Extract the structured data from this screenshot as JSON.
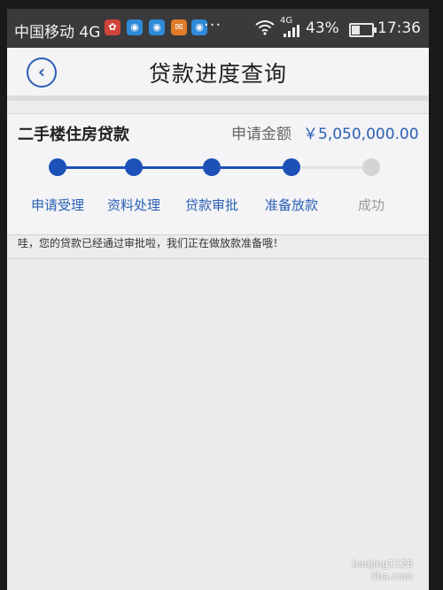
{
  "status_bar": {
    "carrier": "中国移动 4G",
    "network_small": "4G",
    "battery": "43%",
    "time": "17:36",
    "more": "···"
  },
  "header": {
    "back_icon": "chevron-left-icon",
    "title": "贷款进度查询"
  },
  "loan": {
    "type": "二手楼住房贷款",
    "amount_label": "申请金额",
    "amount_value": "￥5,050,000.00"
  },
  "progress": {
    "steps": [
      {
        "label": "申请受理",
        "done": true
      },
      {
        "label": "资料处理",
        "done": true
      },
      {
        "label": "贷款审批",
        "done": true
      },
      {
        "label": "准备放款",
        "done": true
      },
      {
        "label": "成功",
        "done": false
      }
    ],
    "active_color": "#1c51b8",
    "inactive_color": "#d4d4d6"
  },
  "message": "哇，您的贷款已经通过审批啦，我们正在做放款准备哦！",
  "watermark": {
    "line1": "baojing1126",
    "line2": "liba.com"
  }
}
